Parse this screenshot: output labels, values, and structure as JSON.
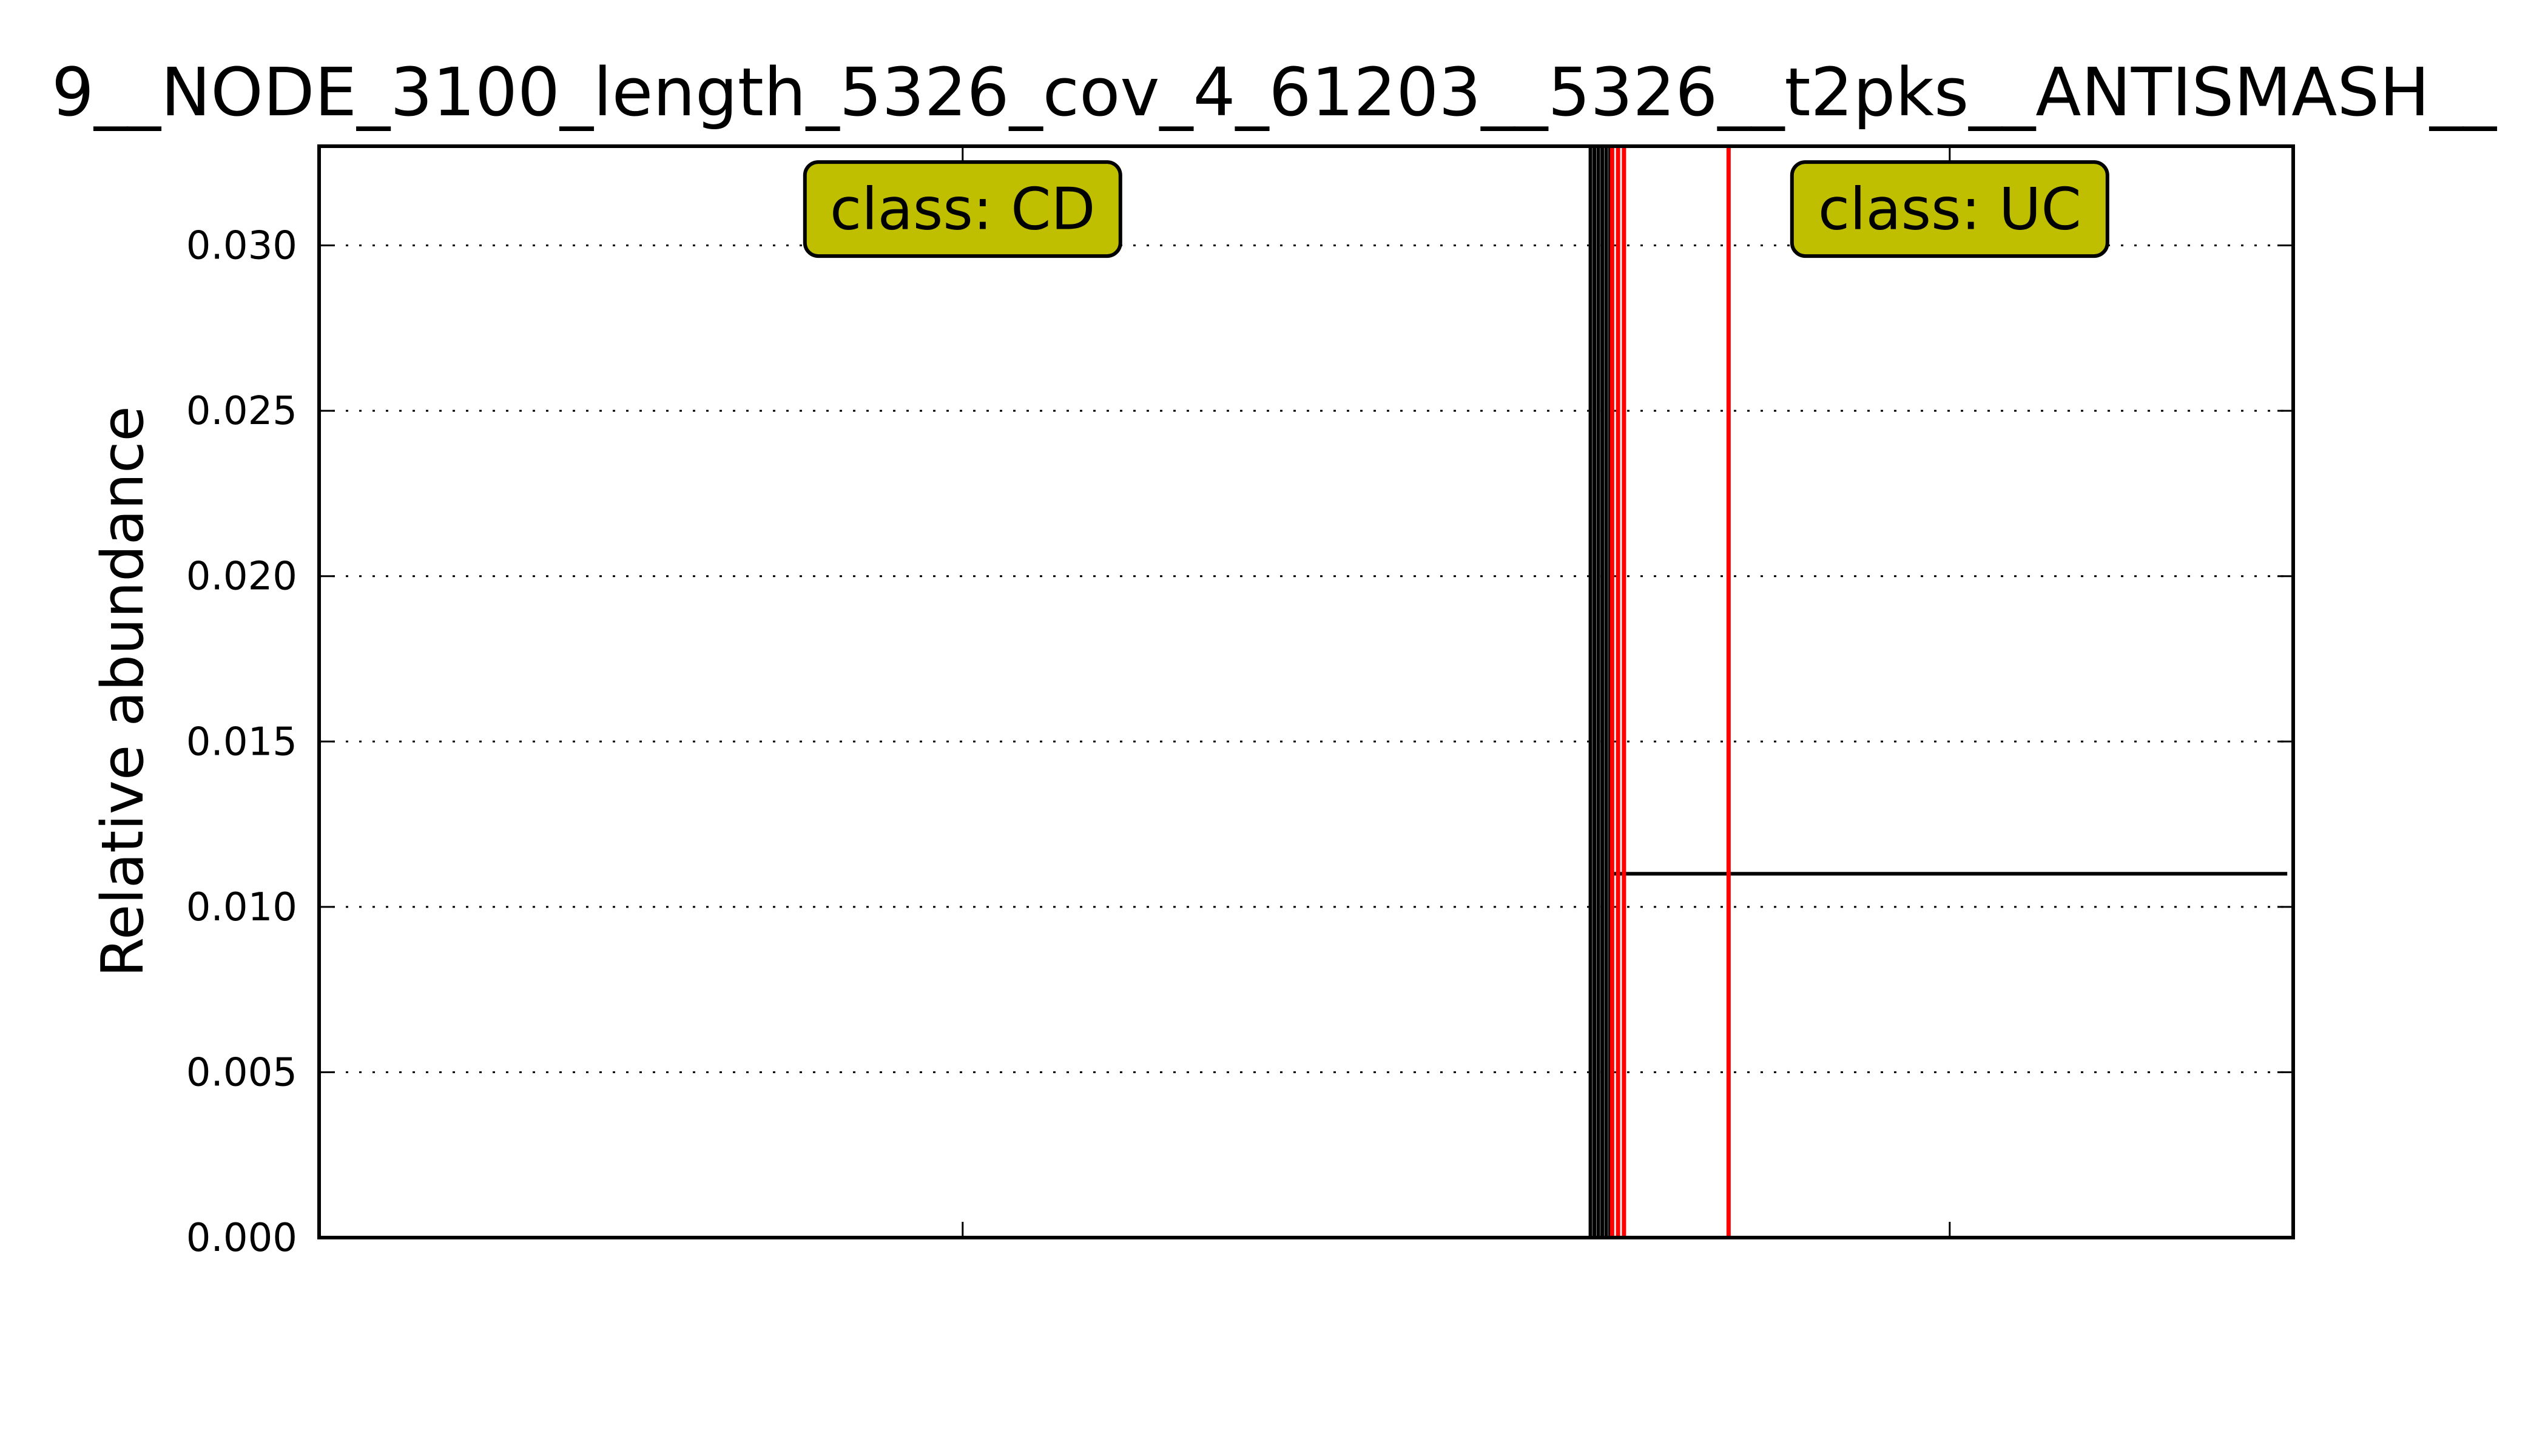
{
  "chart_data": {
    "type": "line",
    "title": "9__NODE_3100_length_5326_cov_4_61203__5326__t2pks__ANTISMASH__",
    "xlabel": "",
    "ylabel": "Relative abundance",
    "xlim": [
      0,
      1
    ],
    "ylim": [
      0,
      0.033
    ],
    "y_ticks": [
      0.0,
      0.005,
      0.01,
      0.015,
      0.02,
      0.025,
      0.03
    ],
    "y_tick_labels": [
      "0.000",
      "0.005",
      "0.010",
      "0.015",
      "0.020",
      "0.025",
      "0.030"
    ],
    "x_tick_positions": [
      0.326,
      0.826
    ],
    "grid": "y-dotted",
    "series": [
      {
        "color": "#000000",
        "points": [
          [
            0.644,
            0.0
          ],
          [
            0.644,
            0.033
          ],
          [
            0.646,
            0.033
          ],
          [
            0.646,
            0.0
          ],
          [
            0.648,
            0.0
          ],
          [
            0.648,
            0.033
          ],
          [
            0.65,
            0.033
          ],
          [
            0.65,
            0.0
          ],
          [
            0.652,
            0.0
          ],
          [
            0.652,
            0.033
          ],
          [
            0.654,
            0.033
          ],
          [
            0.654,
            0.0
          ],
          [
            0.654,
            0.011
          ],
          [
            0.997,
            0.011
          ]
        ]
      }
    ],
    "vlines": [
      {
        "x": 0.655,
        "color": "#ff0000"
      },
      {
        "x": 0.658,
        "color": "#ff0000"
      },
      {
        "x": 0.661,
        "color": "#ff0000"
      },
      {
        "x": 0.714,
        "color": "#ff0000"
      }
    ],
    "annotations": [
      {
        "text": "class: CD",
        "x": 0.326,
        "y": 0.0311,
        "facecolor": "#bfbf00"
      },
      {
        "text": "class: UC",
        "x": 0.826,
        "y": 0.0311,
        "facecolor": "#bfbf00"
      }
    ]
  }
}
